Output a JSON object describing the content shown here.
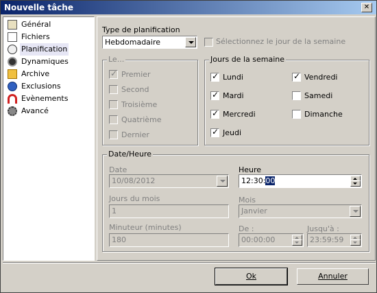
{
  "window": {
    "title": "Nouvelle tâche",
    "close_glyph": "✕"
  },
  "sidebar": {
    "items": [
      {
        "label": "Général",
        "icon": "general-icon"
      },
      {
        "label": "Fichiers",
        "icon": "files-icon"
      },
      {
        "label": "Planification",
        "icon": "clock-icon",
        "selected": true
      },
      {
        "label": "Dynamiques",
        "icon": "dynamic-icon"
      },
      {
        "label": "Archive",
        "icon": "archive-icon"
      },
      {
        "label": "Exclusions",
        "icon": "exclusion-icon"
      },
      {
        "label": "Evènements",
        "icon": "magnet-icon"
      },
      {
        "label": "Avancé",
        "icon": "gear-icon"
      }
    ]
  },
  "schedule": {
    "type_label": "Type de planification",
    "type_value": "Hebdomadaire",
    "select_day_label": "Sélectionnez le jour de la semaine"
  },
  "le_group": {
    "label": "Le...",
    "options": [
      "Premier",
      "Second",
      "Troisième",
      "Quatrième",
      "Dernier"
    ]
  },
  "days_group": {
    "label": "Jours de la semaine",
    "days": [
      {
        "label": "Lundi",
        "checked": true
      },
      {
        "label": "Mardi",
        "checked": true
      },
      {
        "label": "Mercredi",
        "checked": true
      },
      {
        "label": "Jeudi",
        "checked": true
      },
      {
        "label": "Vendredi",
        "checked": true
      },
      {
        "label": "Samedi",
        "checked": false
      },
      {
        "label": "Dimanche",
        "checked": false
      }
    ]
  },
  "datetime_group": {
    "label": "Date/Heure",
    "date_label": "Date",
    "date_value": "10/08/2012",
    "time_label": "Heure",
    "time_hh_mm": "12:30:",
    "time_ss_selected": "00",
    "days_of_month_label": "Jours du mois",
    "days_of_month_value": "1",
    "month_label": "Mois",
    "month_value": "Janvier",
    "timer_label": "Minuteur (minutes)",
    "timer_value": "180",
    "from_label": "De :",
    "from_value": "00:00:00",
    "to_label": "Jusqu'à :",
    "to_value": "23:59:59"
  },
  "buttons": {
    "ok_label": "Ok",
    "cancel_label": "Annuler"
  },
  "colors": {
    "titlebar_start": "#0a246a",
    "titlebar_end": "#a6caf0",
    "face": "#d4d0c8"
  }
}
